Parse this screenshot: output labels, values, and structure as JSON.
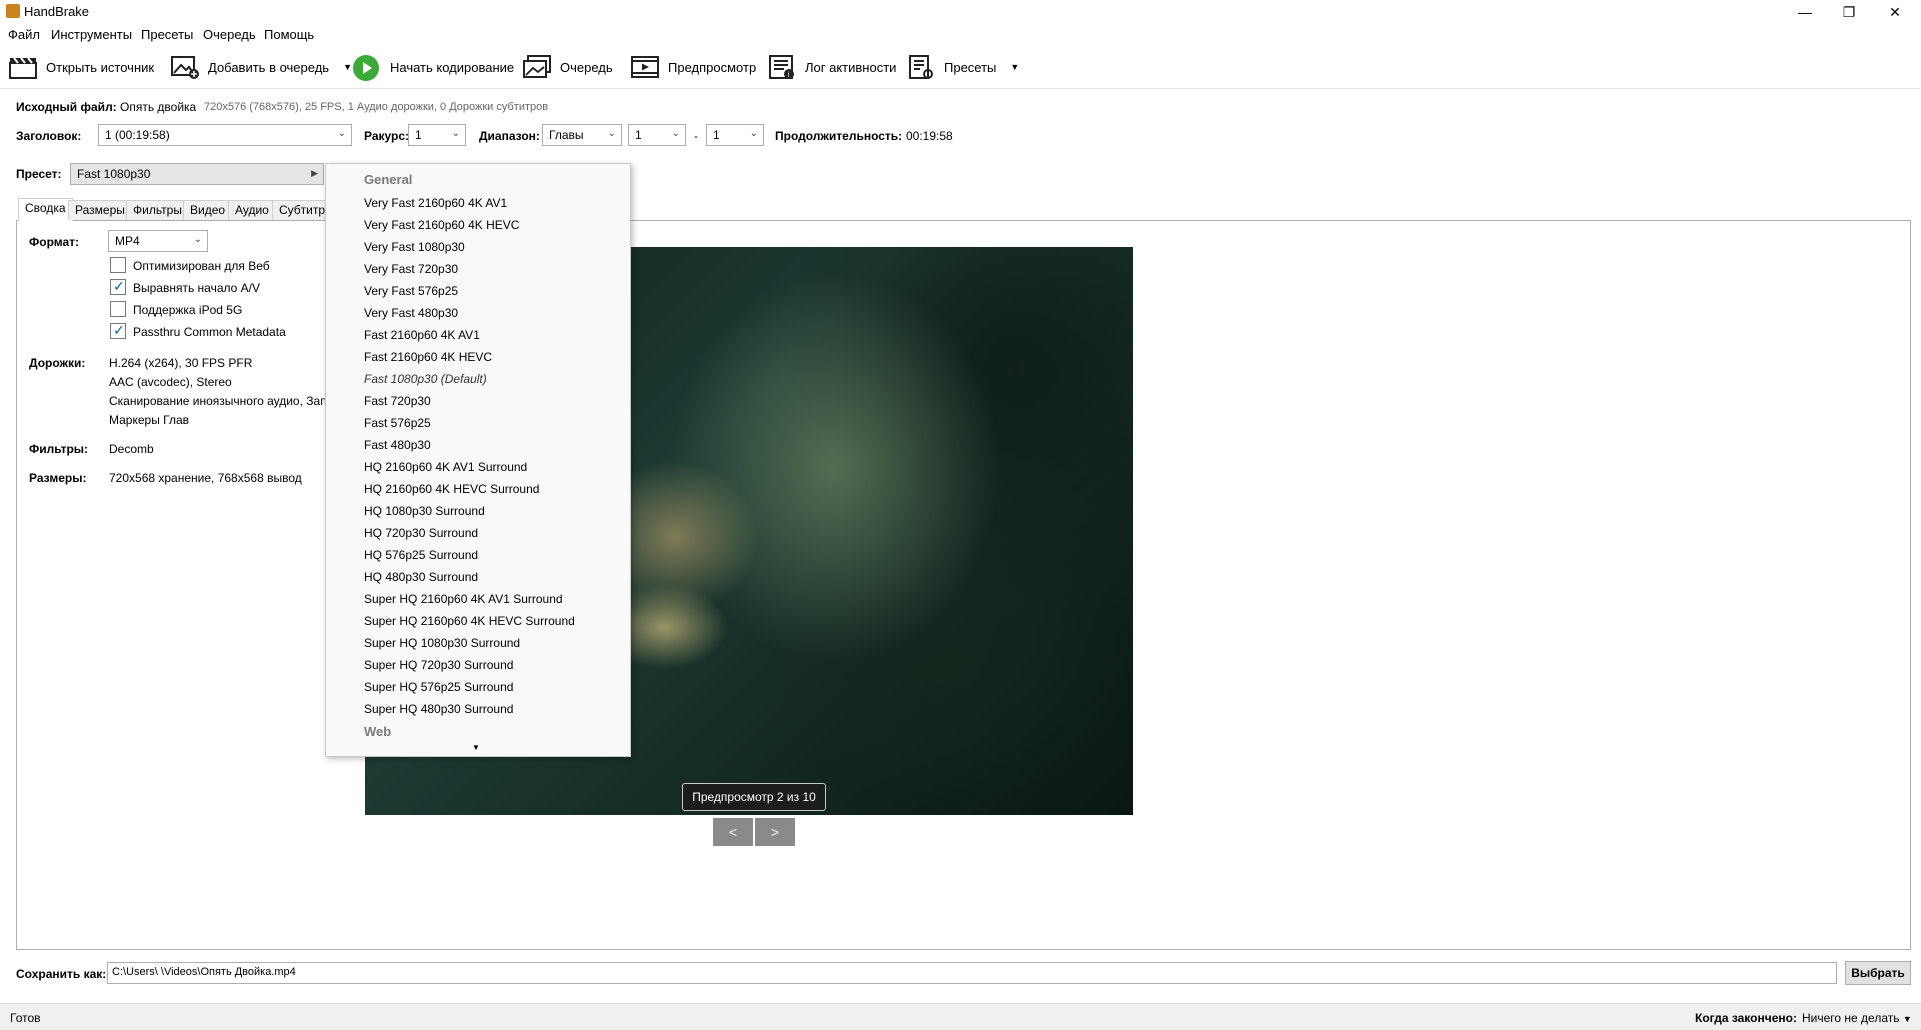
{
  "window": {
    "title": "HandBrake"
  },
  "menu": [
    "Файл",
    "Инструменты",
    "Пресеты",
    "Очередь",
    "Помощь"
  ],
  "toolbar": {
    "open_source": "Открыть источник",
    "add_to_queue": "Добавить в очередь",
    "start_encoding": "Начать кодирование",
    "queue": "Очередь",
    "preview": "Предпросмотр",
    "activity_log": "Лог активности",
    "presets": "Пресеты"
  },
  "source": {
    "label": "Исходный файл:",
    "name": "Опять двойка",
    "info": "720x576 (768x576), 25 FPS, 1 Аудио дорожки, 0 Дорожки субтитров"
  },
  "title_row": {
    "title_label": "Заголовок:",
    "title_value": "1  (00:19:58)",
    "angle_label": "Ракурс:",
    "angle_value": "1",
    "range_label": "Диапазон:",
    "range_type": "Главы",
    "range_start": "1",
    "range_dash": "-",
    "range_end": "1",
    "duration_label": "Продолжительность:",
    "duration_value": "00:19:58"
  },
  "preset": {
    "label": "Пресет:",
    "value": "Fast 1080p30"
  },
  "tabs": [
    "Сводка",
    "Размеры",
    "Фильтры",
    "Видео",
    "Аудио",
    "Субтитры"
  ],
  "summary": {
    "format_label": "Формат:",
    "format_value": "MP4",
    "checkboxes": [
      {
        "label": "Оптимизирован для Веб",
        "checked": false
      },
      {
        "label": "Выравнять начало A/V",
        "checked": true
      },
      {
        "label": "Поддержка iPod 5G",
        "checked": false
      },
      {
        "label": "Passthru Common Metadata",
        "checked": true
      }
    ],
    "tracks_label": "Дорожки:",
    "tracks": [
      "H.264 (x264), 30 FPS PFR",
      "AAC (avcodec), Stereo",
      "Сканирование иноязычного аудио, Запи",
      "Маркеры Глав"
    ],
    "filters_label": "Фильтры:",
    "filters_value": "Decomb",
    "sizes_label": "Размеры:",
    "sizes_value": "720x568 хранение, 768x568 вывод"
  },
  "preset_dropdown": {
    "group_general": "General",
    "items": [
      "Very Fast 2160p60 4K AV1",
      "Very Fast 2160p60 4K HEVC",
      "Very Fast 1080p30",
      "Very Fast 720p30",
      "Very Fast 576p25",
      "Very Fast 480p30",
      "Fast 2160p60 4K AV1",
      "Fast 2160p60 4K HEVC",
      "Fast 1080p30 (Default)",
      "Fast 720p30",
      "Fast 576p25",
      "Fast 480p30",
      "HQ 2160p60 4K AV1 Surround",
      "HQ 2160p60 4K HEVC Surround",
      "HQ 1080p30 Surround",
      "HQ 720p30 Surround",
      "HQ 576p25 Surround",
      "HQ 480p30 Surround",
      "Super HQ 2160p60 4K AV1 Surround",
      "Super HQ 2160p60 4K HEVC Surround",
      "Super HQ 1080p30 Surround",
      "Super HQ 720p30 Surround",
      "Super HQ 576p25 Surround",
      "Super HQ 480p30 Surround"
    ],
    "group_web": "Web"
  },
  "preview": {
    "badge": "Предпросмотр 2 из 10",
    "prev": "<",
    "next": ">"
  },
  "save": {
    "label": "Сохранить как:",
    "path": "C:\\Users\\        \\Videos\\Опять Двойка.mp4",
    "browse": "Выбрать"
  },
  "status": {
    "text": "Готов",
    "when_done_label": "Когда закончено:",
    "when_done_value": "Ничего не делать"
  }
}
